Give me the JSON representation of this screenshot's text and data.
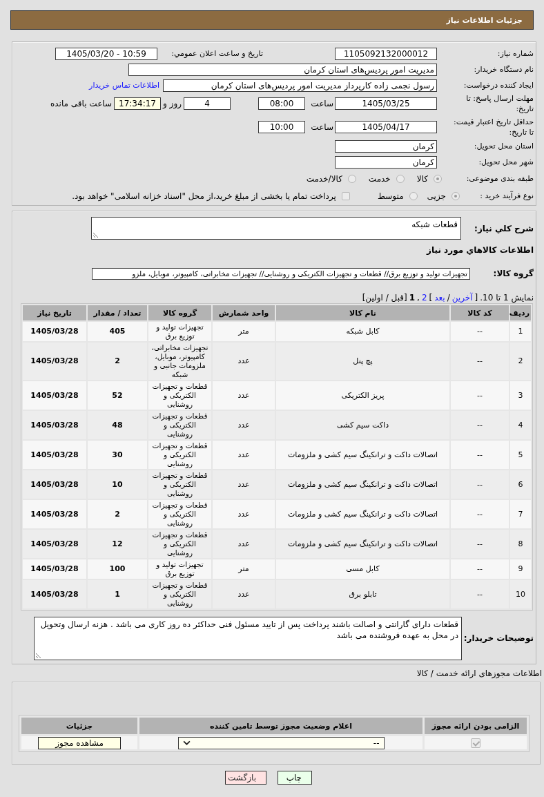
{
  "header": {
    "title": "جزئیات اطلاعات نیاز"
  },
  "need_info": {
    "need_number": {
      "label": "شماره نیاز:",
      "value": "1105092132000012"
    },
    "announce_datetime": {
      "label": "تاريخ و ساعت اعلان عمومي:",
      "value": "1405/03/20 - 10:59"
    },
    "buyer_org": {
      "label": "نام دستگاه خریدار:",
      "value": "مدیریت امور پردیس‌های استان کرمان"
    },
    "requester": {
      "label": "ایجاد کننده درخواست:",
      "value": "رسول نجمی زاده کارپرداز مدیریت امور پردیس‌های استان کرمان",
      "link": "اطلاعات تماس خریدار"
    },
    "reply_deadline": {
      "label": "مهلت ارسال پاسخ: تا تاریخ:",
      "date": "1405/03/25",
      "time_label": "ساعت",
      "time": "08:00",
      "days": "4",
      "days_label": "روز و",
      "remaining": "17:34:17",
      "remaining_label": "ساعت باقی مانده"
    },
    "price_validity": {
      "label": "حداقل تاریخ اعتبار قیمت: تا تاریخ:",
      "date": "1405/04/17",
      "time_label": "ساعت",
      "time": "10:00"
    },
    "delivery_province": {
      "label": "استان محل تحویل:",
      "value": "کرمان"
    },
    "delivery_city": {
      "label": "شهر محل تحویل:",
      "value": "کرمان"
    },
    "subject_category": {
      "label": "طبقه بندی موضوعی:",
      "disabled": true,
      "options": [
        {
          "label": "کالا",
          "selected": true
        },
        {
          "label": "خدمت",
          "selected": false
        },
        {
          "label": "کالا/خدمت",
          "selected": false
        }
      ]
    },
    "purchase_process": {
      "label": "نوع فرآیند خرید :",
      "disabled": true,
      "options": [
        {
          "label": "جزیی",
          "selected": true
        },
        {
          "label": "متوسط",
          "selected": false
        }
      ],
      "treasury": {
        "label": "پرداخت تمام یا بخشی از مبلغ خرید،از محل \"اسناد خزانه اسلامی\" خواهد بود.",
        "checked": false
      }
    }
  },
  "need_details": {
    "summary": {
      "label": "شرح کلي نياز:",
      "value": "قطعات شبکه"
    },
    "items_heading": "اطلاعات کالاهاي مورد نياز",
    "goods_group": {
      "label": "گروه کالا:",
      "value": "تجهیزات تولید و توزیع برق// قطعات و تجهیزات الکتریکی و روشنایی// تجهیزات مخابراتی، کامپیوتر، موبایل، ملزو"
    },
    "pagination": [
      {
        "text": "نمایش 1 تا 10.",
        "kind": "text"
      },
      {
        "text": "[",
        "kind": "text"
      },
      {
        "text": "آخرین",
        "kind": "link"
      },
      {
        "text": "/",
        "kind": "text"
      },
      {
        "text": "بعد",
        "kind": "link"
      },
      {
        "text": "]",
        "kind": "text"
      },
      {
        "text": "2",
        "kind": "link"
      },
      {
        "text": ",",
        "kind": "text"
      },
      {
        "text": "1",
        "kind": "current"
      },
      {
        "text": "[قبل / اولین]",
        "kind": "text"
      }
    ],
    "table": {
      "columns": [
        "ردیف",
        "کد کالا",
        "نام کالا",
        "واحد شمارش",
        "گروه کالا",
        "تعداد / مقدار",
        "تاریخ نیاز"
      ],
      "rows": [
        [
          "1",
          "--",
          "کابل شبکه",
          "متر",
          "تجهیزات تولید و توزیع برق",
          "405",
          "1405/03/28"
        ],
        [
          "2",
          "--",
          "پچ پنل",
          "عدد",
          "تجهیزات مخابراتی، کامپیوتر، موبایل، ملزومات جانبی و شبکه",
          "2",
          "1405/03/28"
        ],
        [
          "3",
          "--",
          "پریز الکتریکی",
          "عدد",
          "قطعات و تجهیزات الکتریکی و روشنایی",
          "52",
          "1405/03/28"
        ],
        [
          "4",
          "--",
          "داکت سیم کشی",
          "عدد",
          "قطعات و تجهیزات الکتریکی و روشنایی",
          "48",
          "1405/03/28"
        ],
        [
          "5",
          "--",
          "اتصالات داکت و ترانکینگ سیم کشی و ملزومات",
          "عدد",
          "قطعات و تجهیزات الکتریکی و روشنایی",
          "30",
          "1405/03/28"
        ],
        [
          "6",
          "--",
          "اتصالات داکت و ترانکینگ سیم کشی و ملزومات",
          "عدد",
          "قطعات و تجهیزات الکتریکی و روشنایی",
          "10",
          "1405/03/28"
        ],
        [
          "7",
          "--",
          "اتصالات داکت و ترانکینگ سیم کشی و ملزومات",
          "عدد",
          "قطعات و تجهیزات الکتریکی و روشنایی",
          "2",
          "1405/03/28"
        ],
        [
          "8",
          "--",
          "اتصالات داکت و ترانکینگ سیم کشی و ملزومات",
          "عدد",
          "قطعات و تجهیزات الکتریکی و روشنایی",
          "12",
          "1405/03/28"
        ],
        [
          "9",
          "--",
          "کابل مسی",
          "متر",
          "تجهیزات تولید و توزیع برق",
          "100",
          "1405/03/28"
        ],
        [
          "10",
          "--",
          "تابلو برق",
          "عدد",
          "قطعات و تجهیزات الکتریکی و روشنایی",
          "1",
          "1405/03/28"
        ]
      ]
    },
    "buyer_notes": {
      "label": "توضیحات خریدار:",
      "value": "قطعات دارای گارانتی و اصالت باشند پرداخت پس از تایید مسئول فنی حداکثر ده روز کاری می باشد . هزنه ارسال وتحویل در محل به عهده فروشنده می باشد"
    }
  },
  "licenses": {
    "title": "اطلاعات مجوزهای ارائه خدمت / کالا",
    "columns": [
      "الزامی بودن ارائه مجوز",
      "اعلام وضعیت مجوز توسط تامین کننده",
      "جزئیات"
    ],
    "rows": [
      {
        "required": {
          "checked": true,
          "disabled": true
        },
        "status": "--",
        "action": "مشاهده مجوز"
      }
    ]
  },
  "buttons": [
    {
      "label": "چاپ",
      "kind": "print"
    },
    {
      "label": "بازگشت",
      "kind": "back"
    }
  ]
}
